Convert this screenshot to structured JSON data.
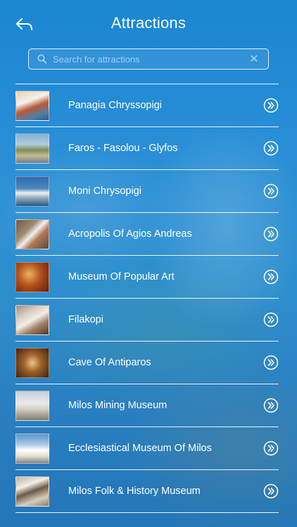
{
  "header": {
    "title": "Attractions"
  },
  "search": {
    "placeholder": "Search for attractions",
    "value": ""
  },
  "attractions": [
    {
      "name": "Panagia Chryssopigi"
    },
    {
      "name": "Faros - Fasolou - Glyfos"
    },
    {
      "name": "Moni Chrysopigi"
    },
    {
      "name": "Acropolis Of Agios Andreas"
    },
    {
      "name": "Museum Of Popular Art"
    },
    {
      "name": "Filakopi"
    },
    {
      "name": "Cave Of Antiparos"
    },
    {
      "name": "Milos Mining Museum"
    },
    {
      "name": "Ecclesiastical Museum Of Milos"
    },
    {
      "name": "Milos Folk & History Museum"
    }
  ],
  "colors": {
    "background": "#1f86cf",
    "text": "#ffffff"
  },
  "icons": {
    "back": "back-arrow-icon",
    "search": "search-icon",
    "clear": "clear-icon",
    "row_action": "double-chevron-right-icon"
  }
}
